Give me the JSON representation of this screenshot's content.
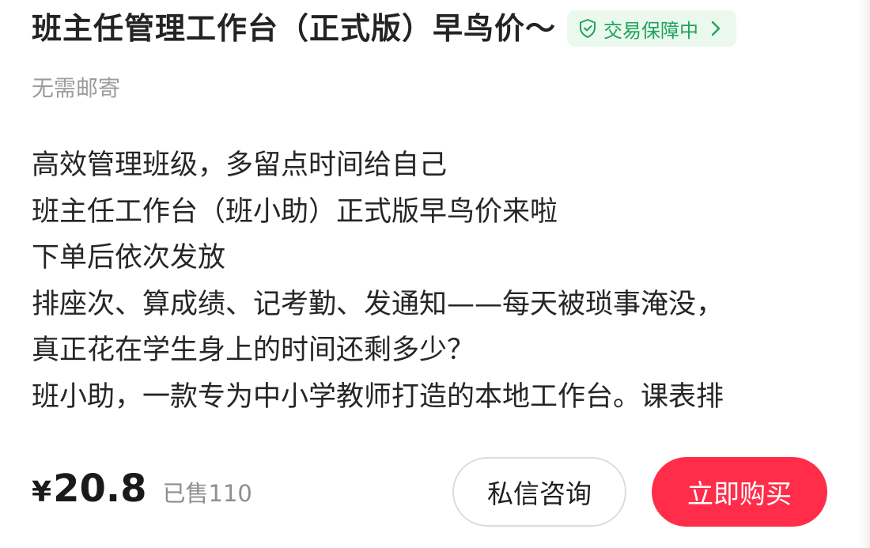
{
  "listing": {
    "title": "班主任管理工作台（正式版）早鸟价～",
    "guarantee_label": "交易保障中",
    "shipping": "无需邮寄",
    "description_lines": [
      "高效管理班级，多留点时间给自己",
      "班主任工作台（班小助）正式版早鸟价来啦",
      "下单后依次发放",
      "排座次、算成绩、记考勤、发通知——每天被琐事淹没，",
      "真正花在学生身上的时间还剩多少？",
      "班小助，一款专为中小学教师打造的本地工作台。课表排"
    ]
  },
  "purchase": {
    "currency_symbol": "¥",
    "price": "20.8",
    "sold_text": "已售110",
    "consult_label": "私信咨询",
    "buy_label": "立即购买"
  },
  "icons": {
    "guarantee": "shield-check-icon",
    "guarantee_arrow": "chevron-right-icon"
  },
  "colors": {
    "guarantee_text": "#1fa35a",
    "guarantee_bg": "#eaf8ee",
    "buy_button": "#ff2d4a",
    "muted_text": "#9c9c9c"
  }
}
